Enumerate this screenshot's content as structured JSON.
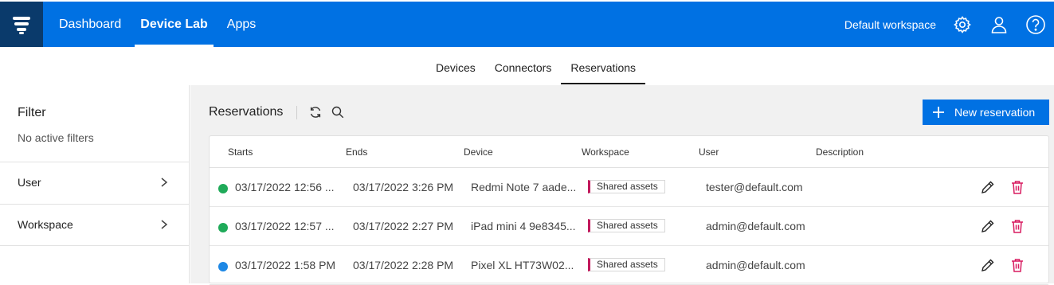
{
  "header": {
    "nav": [
      "Dashboard",
      "Device Lab",
      "Apps"
    ],
    "active_nav": "Device Lab",
    "workspace": "Default workspace"
  },
  "subtabs": [
    "Devices",
    "Connectors",
    "Reservations"
  ],
  "active_subtab": "Reservations",
  "sidebar": {
    "title": "Filter",
    "subtitle": "No active filters",
    "filters": [
      "User",
      "Workspace"
    ]
  },
  "main": {
    "title": "Reservations",
    "new_button": "New reservation",
    "columns": [
      "Starts",
      "Ends",
      "Device",
      "Workspace",
      "User",
      "Description"
    ],
    "rows": [
      {
        "status": "green",
        "starts": "03/17/2022 12:56 ...",
        "ends": "03/17/2022 3:26 PM",
        "device": "Redmi Note 7 aade...",
        "workspace": "Shared assets",
        "user": "tester@default.com",
        "description": ""
      },
      {
        "status": "green",
        "starts": "03/17/2022 12:57 ...",
        "ends": "03/17/2022 2:27 PM",
        "device": "iPad mini 4 9e8345...",
        "workspace": "Shared assets",
        "user": "admin@default.com",
        "description": ""
      },
      {
        "status": "blue",
        "starts": "03/17/2022 1:58 PM",
        "ends": "03/17/2022 2:28 PM",
        "device": "Pixel XL HT73W02...",
        "workspace": "Shared assets",
        "user": "admin@default.com",
        "description": ""
      }
    ]
  },
  "colors": {
    "brand_blue": "#0071e3",
    "logo_bg": "#0a3a6b",
    "status_green": "#1faa59",
    "status_blue": "#1e88e5",
    "delete_red": "#d81b60",
    "workspace_accent": "#c2185b"
  },
  "icons": [
    "logo-icon",
    "gear-icon",
    "user-icon",
    "help-icon",
    "chevron-right-icon",
    "refresh-icon",
    "search-icon",
    "plus-icon",
    "edit-icon",
    "delete-icon"
  ]
}
